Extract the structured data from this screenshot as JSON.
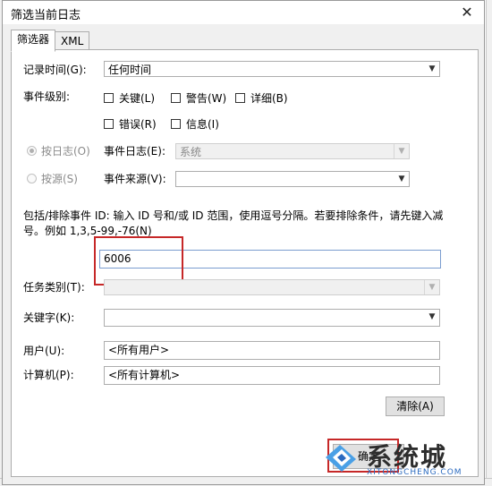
{
  "dialog": {
    "title": "筛选当前日志",
    "close_glyph": "✕"
  },
  "tabs": [
    {
      "label": "筛选器",
      "active": true
    },
    {
      "label": "XML",
      "active": false
    }
  ],
  "logged": {
    "label": "记录时间(G):",
    "value": "任何时间"
  },
  "event_level": {
    "label": "事件级别:",
    "options": [
      {
        "label": "关键(L)",
        "checked": false
      },
      {
        "label": "警告(W)",
        "checked": false
      },
      {
        "label": "详细(B)",
        "checked": false
      },
      {
        "label": "错误(R)",
        "checked": false
      },
      {
        "label": "信息(I)",
        "checked": false
      }
    ]
  },
  "by_log": {
    "radio_label": "按日志(O)",
    "selected": true,
    "field_label": "事件日志(E):",
    "value": "系统"
  },
  "by_source": {
    "radio_label": "按源(S)",
    "selected": false,
    "field_label": "事件来源(V):",
    "value": ""
  },
  "event_ids": {
    "description": "包括/排除事件 ID: 输入 ID 号和/或 ID 范围，使用逗号分隔。若要排除条件，请先键入减号。例如 1,3,5-99,-76(N)",
    "value": "6006"
  },
  "task_category": {
    "label": "任务类别(T):",
    "value": ""
  },
  "keywords": {
    "label": "关键字(K):",
    "value": ""
  },
  "user": {
    "label": "用户(U):",
    "value": "<所有用户>"
  },
  "computer": {
    "label": "计算机(P):",
    "value": "<所有计算机>"
  },
  "buttons": {
    "clear": "清除(A)",
    "ok": "确定"
  },
  "watermark": {
    "brand": "系统城",
    "url": "XITONGCHENG.COM"
  },
  "colors": {
    "highlight": "#c62828",
    "dialog_bg": "#f0f0f0",
    "input_border_focus": "#7a9ccf"
  }
}
